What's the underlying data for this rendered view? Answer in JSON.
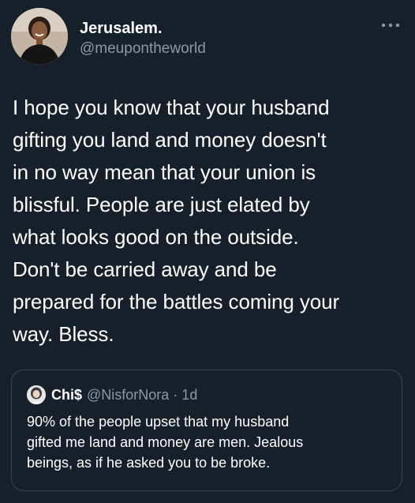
{
  "tweet": {
    "author": {
      "name": "Jerusalem.",
      "handle": "@meupontheworld",
      "avatar_icon": "profile-photo"
    },
    "more_icon": "more-horizontal-icon",
    "text": "I hope you know that your husband\ngifting you land and money doesn't\nin no way mean that your union is\nblissful. People are just elated by\nwhat looks good on the outside.\nDon't be carried away and be\nprepared for the battles coming your\nway. Bless.",
    "quoted": {
      "name": "Chi$",
      "handle": "@NisforNora",
      "separator": "·",
      "time": "1d",
      "meta": "@NisforNora · 1d",
      "avatar_icon": "profile-photo",
      "text": "90% of the people upset that my husband\ngifted me land and money are men. Jealous\nbeings, as if he asked you to be broke."
    }
  },
  "colors": {
    "background": "#15202b",
    "text_primary": "#ffffff",
    "text_secondary": "#8b98a5",
    "border": "#38444d"
  }
}
